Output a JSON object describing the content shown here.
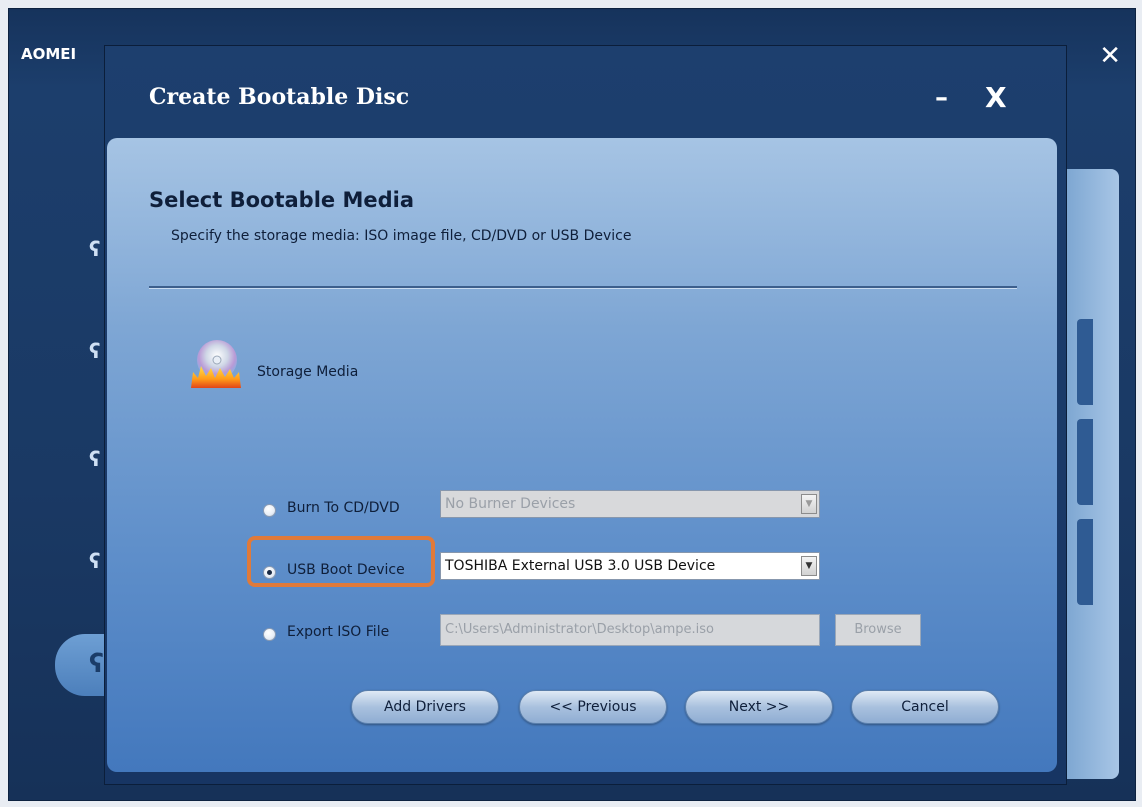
{
  "outer_window": {
    "title": "AOMEI",
    "close_glyph": "✕"
  },
  "dialog": {
    "title": "Create Bootable Disc",
    "minimize_glyph": "–",
    "close_glyph": "X"
  },
  "step": {
    "title": "Select Bootable Media",
    "subtitle": "Specify the storage media: ISO image file, CD/DVD or USB Device"
  },
  "storage_media": {
    "label": "Storage Media",
    "icon": "burning-disc-icon"
  },
  "options": {
    "burn": {
      "label": "Burn To CD/DVD",
      "selected": false,
      "select_value": "No Burner Devices",
      "enabled": false
    },
    "usb": {
      "label": "USB Boot Device",
      "selected": true,
      "select_value": "TOSHIBA External USB 3.0 USB Device",
      "enabled": true
    },
    "iso": {
      "label": "Export ISO File",
      "selected": false,
      "path_value": "C:\\Users\\Administrator\\Desktop\\ampe.iso",
      "browse_label": "Browse",
      "enabled": false
    }
  },
  "buttons": {
    "add_drivers": "Add Drivers",
    "previous": "<< Previous",
    "next": "Next >>",
    "cancel": "Cancel"
  },
  "colors": {
    "highlight": "#e07a3a",
    "dialog_frame": "#1d3f6e",
    "content_top": "#a6c4e4",
    "content_bottom": "#4378bd"
  }
}
